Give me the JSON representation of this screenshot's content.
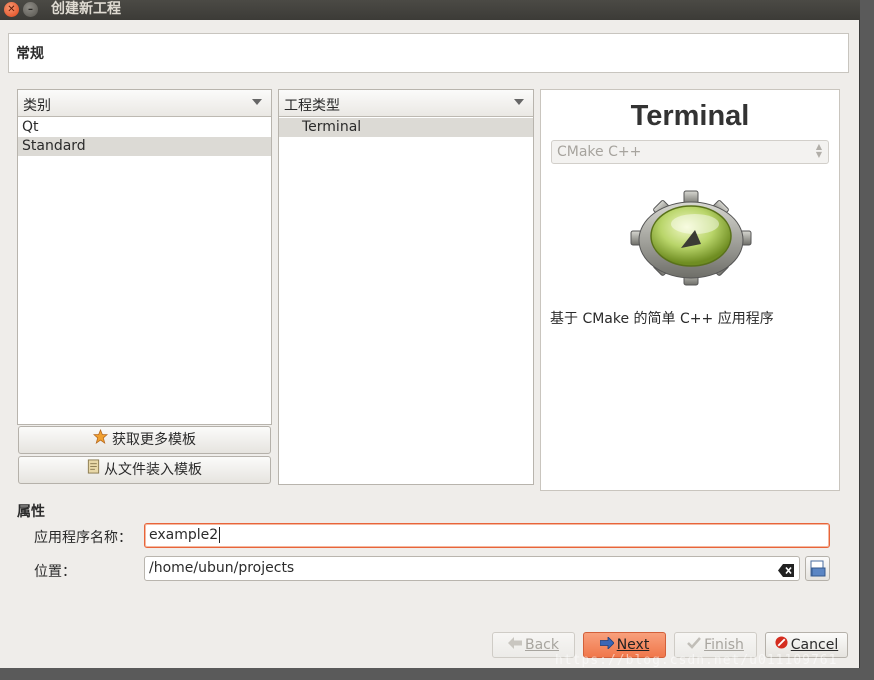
{
  "window": {
    "title": "创建新工程"
  },
  "header": {
    "title": "常规"
  },
  "category_panel": {
    "combo_label": "类别",
    "items": [
      {
        "label": "Qt",
        "selected": false
      },
      {
        "label": "Standard",
        "selected": true
      }
    ],
    "get_more_templates": "获取更多模板",
    "load_from_file": "从文件装入模板"
  },
  "type_panel": {
    "combo_label": "工程类型",
    "items": [
      {
        "label": "Terminal",
        "selected": true
      }
    ]
  },
  "preview": {
    "title": "Terminal",
    "build_system": "CMake C++",
    "description": "基于 CMake 的简单 C++ 应用程序"
  },
  "properties": {
    "section_label": "属性",
    "app_name_label": "应用程序名称：",
    "app_name_value": "example2",
    "location_label": "位置：",
    "location_value": "/home/ubun/projects"
  },
  "buttons": {
    "back": "Back",
    "next": "Next",
    "finish": "Finish",
    "cancel": "Cancel"
  },
  "watermark": "https://blog.csdn.net/u011109761",
  "colors": {
    "accent": "#f0774b",
    "titlebar": "#3c3b37",
    "close": "#e0451b"
  }
}
